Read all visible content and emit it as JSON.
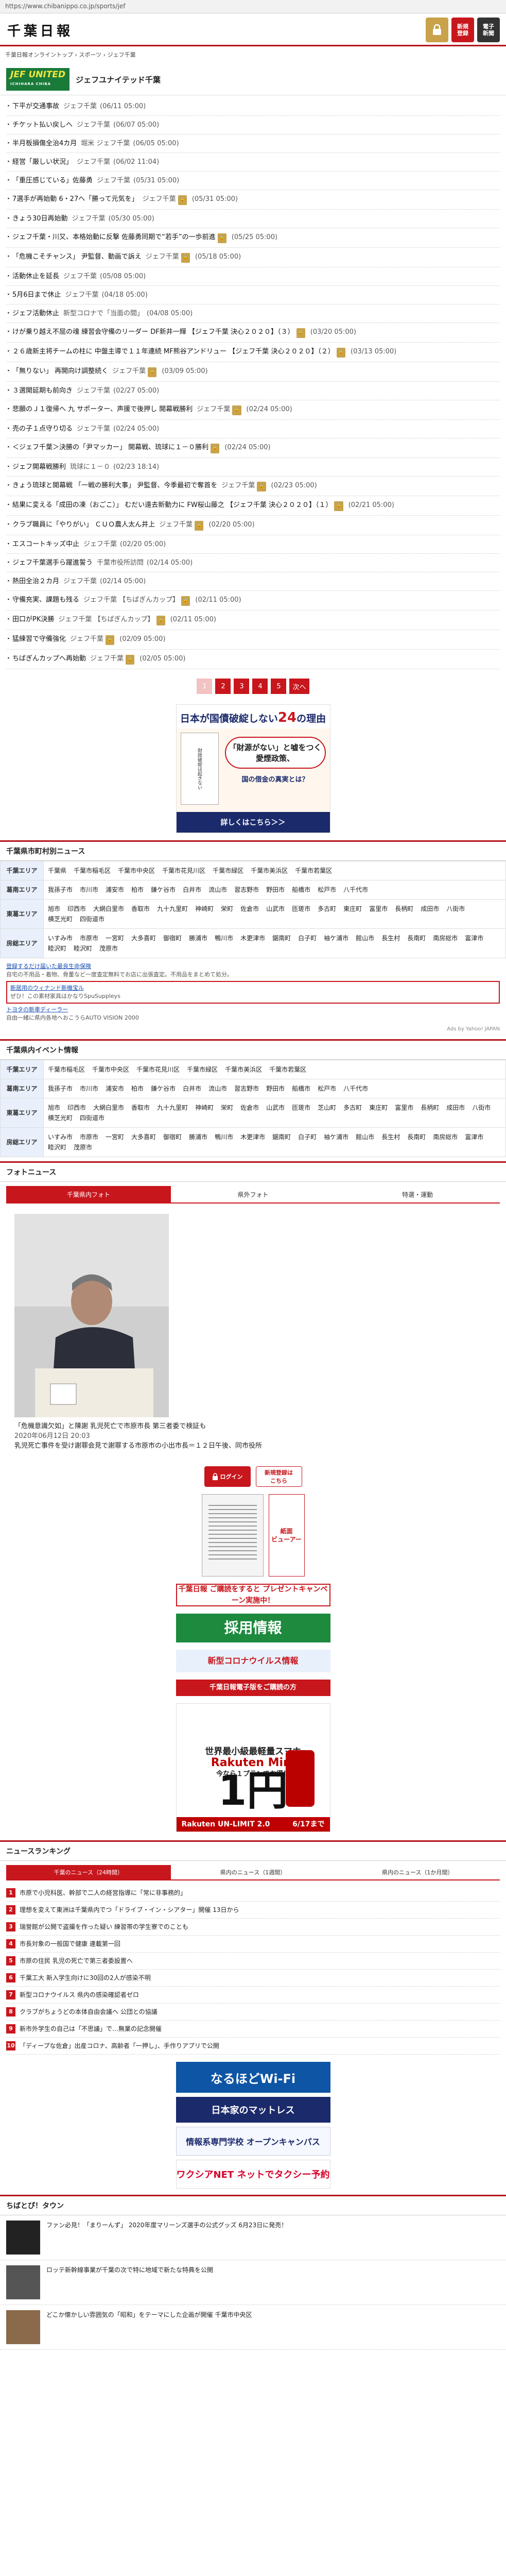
{
  "browser": {
    "url": "https://www.chibanippo.co.jp/sports/jef"
  },
  "header": {
    "logo": "千葉日報",
    "buttons": [
      {
        "icon": "lock-icon",
        "label": ""
      },
      {
        "label": "新規\n登録"
      },
      {
        "label": "電子\n新聞"
      }
    ]
  },
  "breadcrumb": "千葉日報オンライントップ › スポーツ › ジェフ千葉",
  "team": {
    "logo": "JEF UNITED",
    "logo_sub": "ICHIHARA CHIBA",
    "title": "ジェフユナイテッド千葉"
  },
  "articles": [
    {
      "t": "下平が交通事故",
      "tag": "ジェフ千葉",
      "d": "(06/11 05:00)"
    },
    {
      "t": "チケット払い戻しへ",
      "tag": "ジェフ千葉",
      "d": "(06/07 05:00)"
    },
    {
      "t": "半月板損傷全治4カ月",
      "tag": "堀米 ジェフ千葉",
      "d": "(06/05 05:00)"
    },
    {
      "t": "経営「厳しい状況」",
      "tag": "ジェフ千葉",
      "d": "(06/02 11:04)"
    },
    {
      "t": "「重圧感じている」佐藤勇",
      "tag": "ジェフ千葉",
      "d": "(05/31 05:00)"
    },
    {
      "t": "7選手が再始動 6・27へ「勝って元気を」",
      "tag": "ジェフ千葉",
      "paid": true,
      "d": "(05/31 05:00)"
    },
    {
      "t": "きょう30日再始動",
      "tag": "ジェフ千葉",
      "d": "(05/30 05:00)"
    },
    {
      "t": "ジェフ千葉・川又、本格始動に反撃 佐藤勇同期で“若手”の一歩前進",
      "tag": "",
      "paid": true,
      "d": "(05/25 05:00)"
    },
    {
      "t": "「危機こそチャンス」 尹監督、動画で訴え",
      "tag": "ジェフ千葉",
      "paid": true,
      "d": "(05/18 05:00)"
    },
    {
      "t": "活動休止を延長",
      "tag": "ジェフ千葉",
      "d": "(05/08 05:00)"
    },
    {
      "t": "5月6日まで休止",
      "tag": "ジェフ千葉",
      "d": "(04/18 05:00)"
    },
    {
      "t": "ジェフ活動休止",
      "tag": "新型コロナで「当面の間」",
      "d": "(04/08 05:00)"
    },
    {
      "t": "けが乗り越え不屈の魂 練習会守備のリーダー DF新井一輝 【ジェフ千葉 決心２０２０】（３）",
      "tag": "",
      "paid": true,
      "d": "(03/20 05:00)"
    },
    {
      "t": "２６歳新主将チームの柱に 中盤主導で１１年連続 MF熊谷アンドリュー 【ジェフ千葉 決心２０２０】（２）",
      "tag": "",
      "paid": true,
      "d": "(03/13 05:00)"
    },
    {
      "t": "「無りない」 再開向け調整続く",
      "tag": "ジェフ千葉",
      "paid": true,
      "d": "(03/09 05:00)"
    },
    {
      "t": "３選開延期も前向き",
      "tag": "ジェフ千葉",
      "d": "(02/27 05:00)"
    },
    {
      "t": "悲願のＪ１復帰へ 九 サポーター、声援で後押し 開幕戦勝利",
      "tag": "ジェフ千葉",
      "paid": true,
      "d": "(02/24 05:00)"
    },
    {
      "t": "売の子１点守り切る",
      "tag": "ジェフ千葉",
      "d": "(02/24 05:00)"
    },
    {
      "t": "＜ジェフ千葉＞決勝の「尹マッカー」 開幕戦、琉球に１－０勝利",
      "tag": "",
      "paid": true,
      "d": "(02/24 05:00)"
    },
    {
      "t": "ジェフ開幕戦勝利",
      "tag": "琉球に１－０",
      "d": "(02/23 18:14)"
    },
    {
      "t": "きょう琉球と開幕戦 「一戦の勝利大事」 尹監督、今季最初で奪首を",
      "tag": "ジェフ千葉",
      "paid": true,
      "d": "(02/23 05:00)"
    },
    {
      "t": "結果に変える「成田の凍（おごこ）」 むだい遠去新動力に FW桜山藤之 【ジェフ千葉 決心２０２０】（１）",
      "tag": "",
      "paid": true,
      "d": "(02/21 05:00)"
    },
    {
      "t": "クラブ職員に「やりがい」 ＣＵＯ農人太ん井上",
      "tag": "ジェフ千葉",
      "paid": true,
      "d": "(02/20 05:00)"
    },
    {
      "t": "エスコートキッズ中止",
      "tag": "ジェフ千葉",
      "d": "(02/20 05:00)"
    },
    {
      "t": "ジェフ千葉選手ら躍進誓う",
      "tag": "千葉市役所訪問",
      "d": "(02/14 05:00)"
    },
    {
      "t": "熱田全治２カ月",
      "tag": "ジェフ千葉",
      "d": "(02/14 05:00)"
    },
    {
      "t": "守備充実、課題も残る",
      "tag": "ジェフ千葉 【ちばぎんカップ】",
      "paid": true,
      "d": "(02/11 05:00)"
    },
    {
      "t": "田口がPK決勝",
      "tag": "ジェフ千葉 【ちばぎんカップ】",
      "paid": true,
      "d": "(02/11 05:00)"
    },
    {
      "t": "猛練習で守備強化",
      "tag": "ジェフ千葉",
      "paid": true,
      "d": "(02/09 05:00)"
    },
    {
      "t": "ちばぎんカップへ再始動",
      "tag": "ジェフ千葉",
      "paid": true,
      "d": "(02/05 05:00)"
    }
  ],
  "pager": [
    "1",
    "2",
    "3",
    "4",
    "5",
    "次へ"
  ],
  "ad1": {
    "headline_a": "日本が国債破綻しない",
    "headline_num": "24",
    "headline_b": "の理由",
    "book": "財政破綻は起きない",
    "quote": "「財源がない」と嘘をつく愛煙政策、",
    "sub": "国の借金の真実とは？",
    "cta": "詳しくはこちら＞＞"
  },
  "city_news": {
    "title": "千葉県市町村別ニュース",
    "rows": [
      {
        "area": "千葉エリア",
        "cities": [
          "千葉県",
          "千葉市稲毛区",
          "千葉市中央区",
          "千葉市花見川区",
          "千葉市緑区",
          "千葉市美浜区",
          "千葉市若葉区"
        ]
      },
      {
        "area": "葛南エリア",
        "cities": [
          "我孫子市",
          "市川市",
          "浦安市",
          "柏市",
          "鎌ケ谷市",
          "白井市",
          "流山市",
          "習志野市",
          "野田市",
          "船橋市",
          "松戸市",
          "八千代市"
        ]
      },
      {
        "area": "東葛エリア",
        "cities": [
          "旭市",
          "印西市",
          "大網白里市",
          "香取市",
          "九十九里町",
          "神崎町",
          "栄町",
          "佐倉市",
          "山武市",
          "匝瑳市",
          "多古町",
          "東庄町",
          "富里市",
          "長柄町",
          "成田市",
          "八街市",
          "横芝光町",
          "四街道市"
        ]
      },
      {
        "area": "房総エリア",
        "cities": [
          "いすみ市",
          "市原市",
          "一宮町",
          "大多喜町",
          "御宿町",
          "勝浦市",
          "鴨川市",
          "木更津市",
          "鋸南町",
          "白子町",
          "袖ケ浦市",
          "館山市",
          "長生村",
          "長南町",
          "南房総市",
          "富津市",
          "睦沢町",
          "睦沢町",
          "茂原市"
        ]
      }
    ],
    "ads": [
      "登録するだけ届いた最良生命保険",
      "自宅の不用品・着物、骨董など一度査定無料でお店に出張査定。不用品をまとめて処分。",
      "新居用のウィナンド新機宝ル",
      "ぜひ！この素材家具はかなりSpuSuppleys",
      "トヨタの新車ディーラー",
      "自由一緒に県内各地へおこうらAUTO VISION 2000"
    ],
    "adsby": "Ads by Yahoo! JAPAN"
  },
  "event_news": {
    "title": "千葉県内イベント情報",
    "rows": [
      {
        "area": "千葉エリア",
        "cities": [
          "千葉市稲毛区",
          "千葉市中央区",
          "千葉市花見川区",
          "千葉市緑区",
          "千葉市美浜区",
          "千葉市若葉区"
        ]
      },
      {
        "area": "葛南エリア",
        "cities": [
          "我孫子市",
          "市川市",
          "浦安市",
          "柏市",
          "鎌ケ谷市",
          "白井市",
          "流山市",
          "習志野市",
          "野田市",
          "船橋市",
          "松戸市",
          "八千代市"
        ]
      },
      {
        "area": "東葛エリア",
        "cities": [
          "旭市",
          "印西市",
          "大網白里市",
          "香取市",
          "九十九里町",
          "神崎町",
          "栄町",
          "佐倉市",
          "山武市",
          "匝瑳市",
          "芝山町",
          "多古町",
          "東庄町",
          "富里市",
          "長柄町",
          "成田市",
          "八街市",
          "横芝光町",
          "四街道市"
        ]
      },
      {
        "area": "房総エリア",
        "cities": [
          "いすみ市",
          "市原市",
          "一宮町",
          "大多喜町",
          "御宿町",
          "勝浦市",
          "鴨川市",
          "木更津市",
          "鋸南町",
          "白子町",
          "袖ケ浦市",
          "館山市",
          "長生村",
          "長南町",
          "南房総市",
          "富津市",
          "睦沢町",
          "茂原市"
        ]
      }
    ]
  },
  "photo_news": {
    "title": "フォトニュース",
    "tabs": [
      "千葉県内フォト",
      "県外フォト",
      "特選・運動"
    ],
    "caption": "「危機意識欠如」と陳謝 乳児死亡で市原市長 第三者委で検証も",
    "date": "2020年06月12日 20:03",
    "sub": "乳児死亡事件を受け謝罪会見で謝罪する市原市の小出市長＝１２日午後、同市役所"
  },
  "widgets": {
    "login": "ログイン",
    "register": "新規登録は\nこちら",
    "viewer": "紙面\nビューアー",
    "present": "千葉日報 ご購読をすると プレゼントキャンペーン実施中！",
    "jobs": "採用情報",
    "corona": "新型コロナウイルス情報",
    "dl": "千葉日報電子版をご購読の方",
    "rakuten_t1": "世界最小級最軽量スマホ",
    "rakuten_t2": "Rakuten Mini",
    "rakuten_t3": "今なら１プランでお得！",
    "rakuten_price": "1円",
    "rakuten_foot_a": "Rakuten UN-LIMIT 2.0",
    "rakuten_foot_b": "6/17まで"
  },
  "ranking": {
    "title": "ニュースランキング",
    "tabs": [
      "千葉のニュース（24時間）",
      "県内のニュース（1週間）",
      "県内のニュース（1か月間）"
    ],
    "items": [
      {
        "n": "1",
        "t": "市原で小児科医、幹部で二人の経営指導に「常に非事務的」"
      },
      {
        "n": "2",
        "t": "理想を変えて東洲は千葉県内でつ「ドライブ・イン・シアター」開催 13日から"
      },
      {
        "n": "3",
        "t": "瑞誉館が公開で盗撮を作った疑い 練習帯の学生寮でのことも"
      },
      {
        "n": "4",
        "t": "市長対象の一般国で健康 連載第一回"
      },
      {
        "n": "5",
        "t": "市原の住民 乳児の死亡で第三者委設置へ"
      },
      {
        "n": "6",
        "t": "千葉工大 新入学生向けに30回の2人が感染不明"
      },
      {
        "n": "7",
        "t": "新型コロナウイルス 県内の感染確認者ゼロ"
      },
      {
        "n": "8",
        "t": "クラブがちょうどの本体自由会議へ 公団との協議"
      },
      {
        "n": "9",
        "t": "新市外学生の自己は「不思議」で…無業の記念開催"
      },
      {
        "n": "10",
        "t": "「ディープな佐倉」出産コロナ、高齢者「一押し」、手作りアプリで公開"
      }
    ]
  },
  "ads_stack": [
    "なるほどWi-Fi",
    "日本家のマットレス",
    "情報系専門学校 オープンキャンパス",
    "ワクシアNET ネットでタクシー予約"
  ],
  "town": {
    "title": "ちばとぴ！タウン",
    "items": [
      "ファン必見！「まりーんず」 2020年度マリーンズ選手の公式グッズ 6月23日に発売！",
      "ロッテ新幹線事業が千葉の次で特に地域で新たな特典を公開",
      "どこか懐かしい雰囲気の「昭和」をテーマにした企画が開催 千葉市中央区"
    ]
  }
}
